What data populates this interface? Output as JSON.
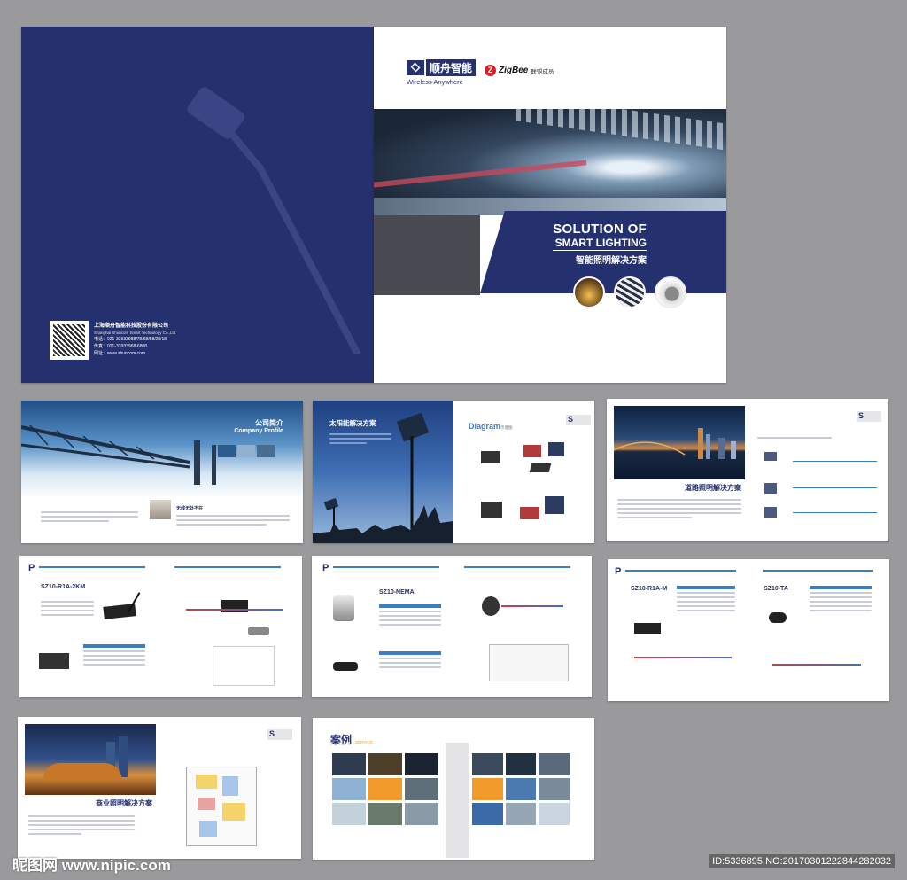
{
  "cover": {
    "brand_cn": "顺舟智能",
    "brand_en": "Wireless Anywhere",
    "zigbee": "ZigBee",
    "zigbee_member": "联盟成员",
    "title_line1": "SOLUTION OF",
    "title_line2": "SMART LIGHTING",
    "title_cn": "智能照明解决方案",
    "company_cn": "上海顺舟智能科技股份有限公司",
    "company_en": "Shanghai Shuncom Smart Technology Co.,Ltd",
    "phone": "电话：021-33933988/78/68/58/28/18",
    "fax": "传真：021-33933968-6808",
    "web": "网址：www.shuncom.com"
  },
  "pages": {
    "profile_cn": "公司简介",
    "profile_en": "Company Profile",
    "wireless_tag": "无线无处不在",
    "solar_title": "太阳能解决方案",
    "diagram_title": "Diagram",
    "diagram_cn": "示意图",
    "road_title": "道路照明解决方案",
    "commercial_title": "商业照明解决方案",
    "case_title": "案例",
    "case_en": "SERVICE",
    "products": {
      "p1": "SZ10-R1A-2KM",
      "p2": "SZ10-NEMA",
      "p3": "SZ10-R1A-M",
      "p4": "SZ10-TA"
    },
    "product_mark": "P"
  },
  "watermark": {
    "site": "昵图网 www.nipic.com",
    "id": "ID:5336895 NO:20170301222844282032"
  },
  "colors": {
    "navy": "#25306e",
    "accent_blue": "#3a7ec8",
    "background": "#9a9a9c"
  }
}
